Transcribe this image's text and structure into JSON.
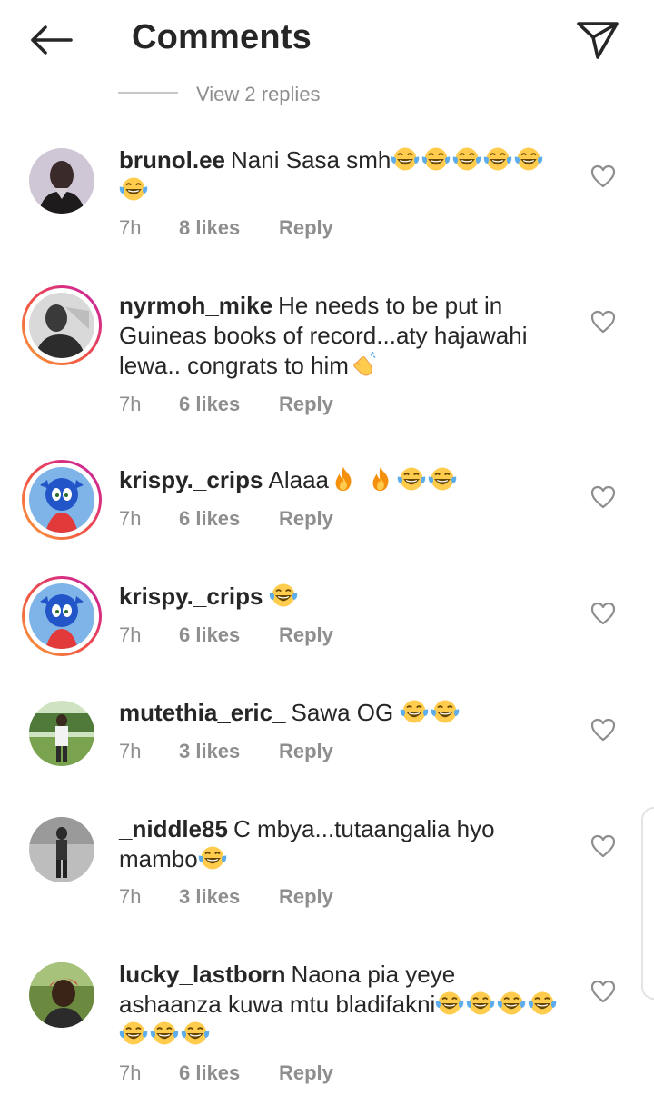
{
  "header": {
    "title": "Comments",
    "back_icon": "arrow-left-icon",
    "send_icon": "paper-plane-icon"
  },
  "view_replies": "View 2 replies",
  "colors": {
    "text": "#262626",
    "muted": "#8e8e8e",
    "story_ring": [
      "#f9a33a",
      "#f15245",
      "#d92e7f",
      "#c028a8"
    ]
  },
  "comments": [
    {
      "username": "brunol.ee",
      "text": "Nani Sasa smh",
      "emojis": "😂😂😂😂😂😂",
      "time": "7h",
      "likes": "8 likes",
      "reply": "Reply"
    },
    {
      "username": "nyrmoh_mike",
      "text": "He needs to be put in Guineas books of record...aty hajawahi lewa.. congrats to him",
      "emojis": "👋",
      "time": "7h",
      "likes": "6 likes",
      "reply": "Reply"
    },
    {
      "username": "krispy._crips",
      "text": "Alaaa",
      "emojis": "🔥🔥😂😂",
      "time": "7h",
      "likes": "6 likes",
      "reply": "Reply"
    },
    {
      "username": "krispy._crips",
      "text": "",
      "emojis": "😂",
      "time": "7h",
      "likes": "6 likes",
      "reply": "Reply"
    },
    {
      "username": "mutethia_eric_",
      "text": "Sawa OG",
      "emojis": "😂😂",
      "time": "7h",
      "likes": "3 likes",
      "reply": "Reply"
    },
    {
      "username": "_niddle85",
      "text": "C mbya...tutaangalia hyo mambo",
      "emojis": "😂",
      "time": "7h",
      "likes": "3 likes",
      "reply": "Reply"
    },
    {
      "username": "lucky_lastborn",
      "text": "Naona pia yeye ashaanza kuwa mtu bladifakni",
      "emojis": "😂😂😂😂😂😂😂",
      "time": "7h",
      "likes": "6 likes",
      "reply": "Reply"
    }
  ]
}
